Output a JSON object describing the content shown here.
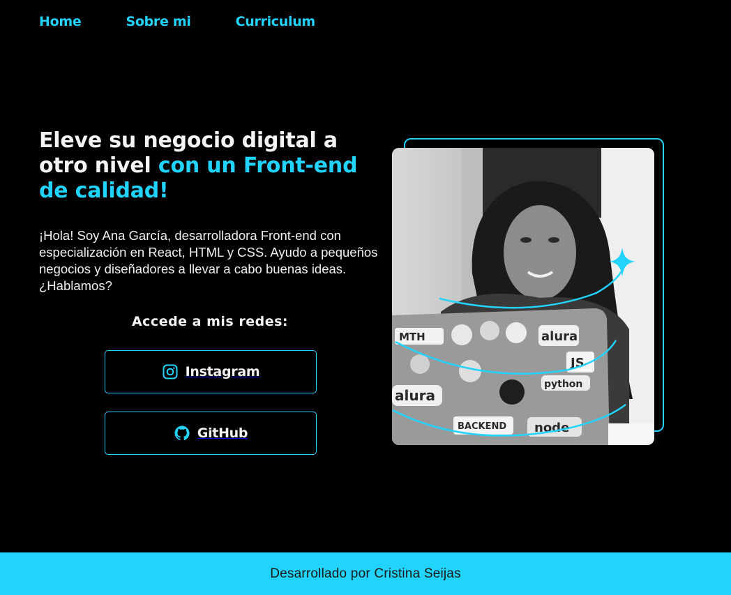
{
  "nav": {
    "home": "Home",
    "about": "Sobre mi",
    "cv": "Curriculum"
  },
  "hero": {
    "title_part1": "Eleve su negocio digital a otro nivel ",
    "title_accent": "con un Front-end de calidad!",
    "intro": "¡Hola! Soy Ana García, desarrolladora Front-end con especialización en React, HTML y CSS. Ayudo a pequeños negocios y diseñadores a llevar a cabo buenas ideas. ¿Hablamos?"
  },
  "social": {
    "title": "Accede a mis redes:",
    "instagram_label": "Instagram",
    "instagram_icon": "instagram-icon",
    "github_label": "GitHub",
    "github_icon": "github-icon"
  },
  "photo": {
    "sticker_texts": [
      "MTH",
      "alura",
      "JS",
      "python",
      "alura",
      "BACKEND",
      "node"
    ]
  },
  "footer": {
    "text": "Desarrollado por Cristina Seijas"
  },
  "colors": {
    "accent": "#22d4fd",
    "background": "#000000",
    "footer_text": "#1a1a1a"
  }
}
